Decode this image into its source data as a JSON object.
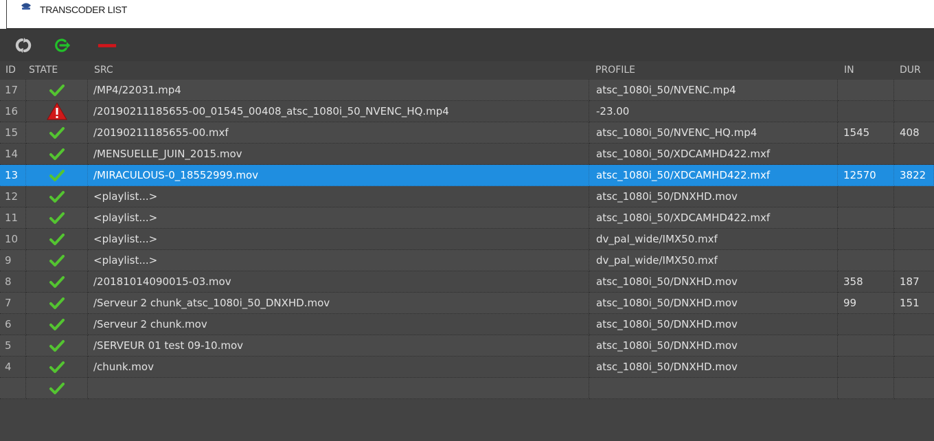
{
  "window": {
    "title": "TRANSCODER LIST"
  },
  "toolbar": {
    "buttons": [
      {
        "name": "refresh-button",
        "icon": "refresh-icon",
        "color": "#c8c8c8"
      },
      {
        "name": "restart-button",
        "icon": "restart-icon",
        "color": "#22c12a"
      },
      {
        "name": "remove-button",
        "icon": "minus-icon",
        "color": "#d0161b"
      }
    ]
  },
  "columns": {
    "id": "ID",
    "state": "STATE",
    "src": "SRC",
    "profile": "PROFILE",
    "in": "IN",
    "dur": "DUR"
  },
  "selected_row_color": "#1f8ee0",
  "rows": [
    {
      "id": "17",
      "state": "ok",
      "src": "/MP4/22031.mp4",
      "profile": "atsc_1080i_50/NVENC.mp4",
      "in": "",
      "dur": ""
    },
    {
      "id": "16",
      "state": "error",
      "src": "/20190211185655-00_01545_00408_atsc_1080i_50_NVENC_HQ.mp4",
      "profile": "-23.00",
      "in": "",
      "dur": ""
    },
    {
      "id": "15",
      "state": "ok",
      "src": "/20190211185655-00.mxf",
      "profile": "atsc_1080i_50/NVENC_HQ.mp4",
      "in": "1545",
      "dur": "408"
    },
    {
      "id": "14",
      "state": "ok",
      "src": "/MENSUELLE_JUIN_2015.mov",
      "profile": "atsc_1080i_50/XDCAMHD422.mxf",
      "in": "",
      "dur": ""
    },
    {
      "id": "13",
      "state": "ok",
      "src": "/MIRACULOUS-0_18552999.mov",
      "profile": "atsc_1080i_50/XDCAMHD422.mxf",
      "in": "12570",
      "dur": "3822",
      "selected": true
    },
    {
      "id": "12",
      "state": "ok",
      "src": "<playlist...>",
      "profile": "atsc_1080i_50/DNXHD.mov",
      "in": "",
      "dur": ""
    },
    {
      "id": "11",
      "state": "ok",
      "src": "<playlist...>",
      "profile": "atsc_1080i_50/XDCAMHD422.mxf",
      "in": "",
      "dur": ""
    },
    {
      "id": "10",
      "state": "ok",
      "src": "<playlist...>",
      "profile": "dv_pal_wide/IMX50.mxf",
      "in": "",
      "dur": ""
    },
    {
      "id": "9",
      "state": "ok",
      "src": "<playlist...>",
      "profile": "dv_pal_wide/IMX50.mxf",
      "in": "",
      "dur": ""
    },
    {
      "id": "8",
      "state": "ok",
      "src": "/20181014090015-03.mov",
      "profile": "atsc_1080i_50/DNXHD.mov",
      "in": "358",
      "dur": "187"
    },
    {
      "id": "7",
      "state": "ok",
      "src": "/Serveur 2  chunk_atsc_1080i_50_DNXHD.mov",
      "profile": "atsc_1080i_50/DNXHD.mov",
      "in": "99",
      "dur": "151"
    },
    {
      "id": "6",
      "state": "ok",
      "src": "/Serveur 2  chunk.mov",
      "profile": "atsc_1080i_50/DNXHD.mov",
      "in": "",
      "dur": ""
    },
    {
      "id": "5",
      "state": "ok",
      "src": "/SERVEUR 01 test 09-10.mov",
      "profile": "atsc_1080i_50/DNXHD.mov",
      "in": "",
      "dur": ""
    },
    {
      "id": "4",
      "state": "ok",
      "src": "/chunk.mov",
      "profile": "atsc_1080i_50/DNXHD.mov",
      "in": "",
      "dur": ""
    },
    {
      "id": "",
      "state": "ok",
      "src": "",
      "profile": "",
      "in": "",
      "dur": ""
    }
  ]
}
